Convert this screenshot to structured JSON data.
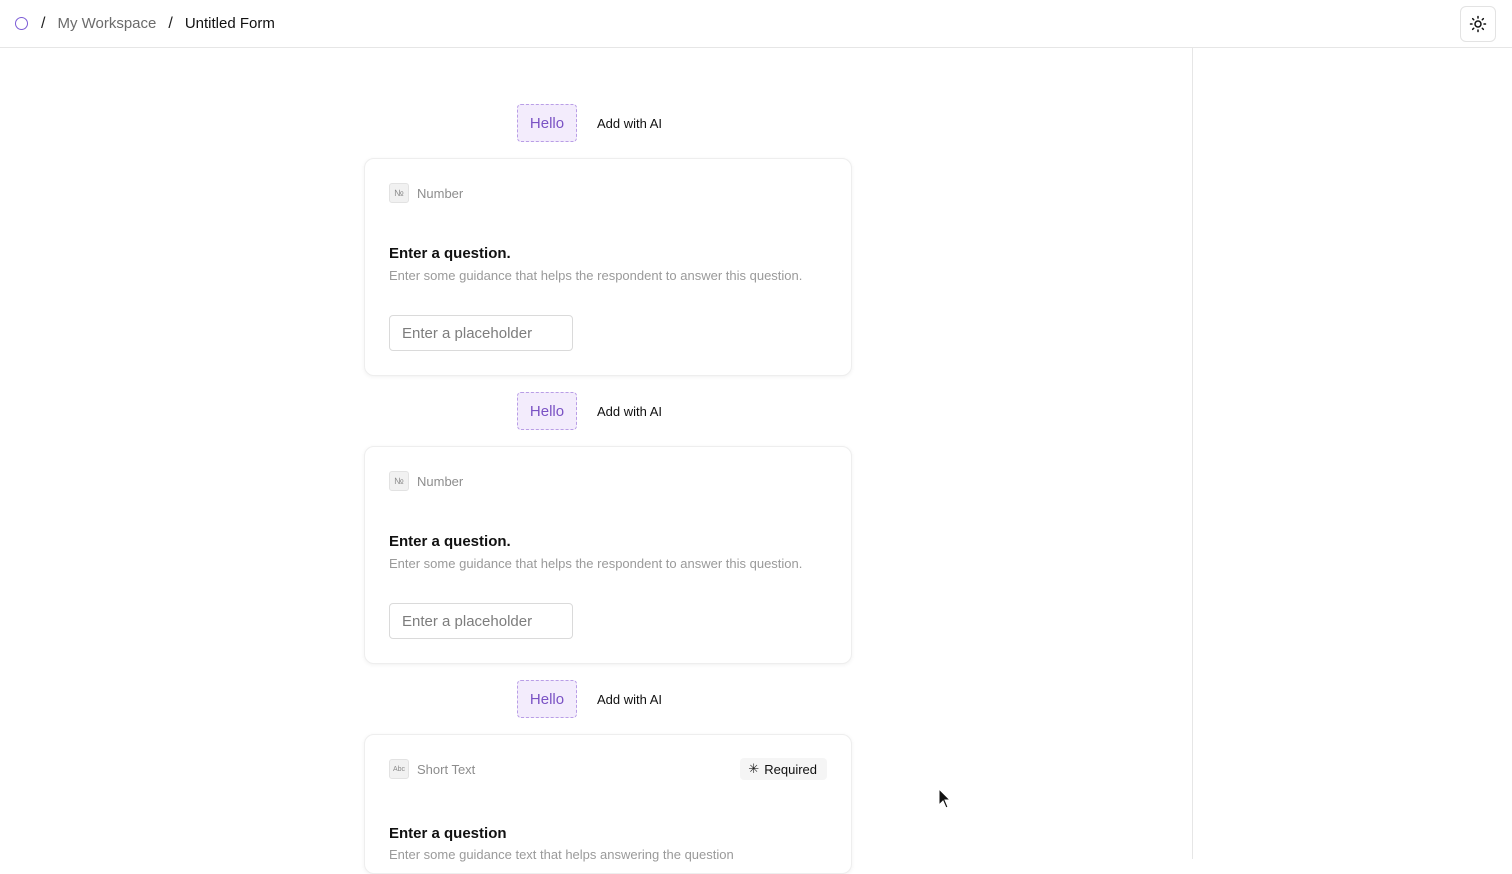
{
  "breadcrumb": {
    "separator": "/",
    "workspace": "My Workspace",
    "form": "Untitled Form"
  },
  "header": {
    "theme_icon": "sun-icon"
  },
  "adders": [
    {
      "hello_label": "Hello",
      "ai_label": "Add with AI"
    },
    {
      "hello_label": "Hello",
      "ai_label": "Add with AI"
    },
    {
      "hello_label": "Hello",
      "ai_label": "Add with AI"
    }
  ],
  "cards": [
    {
      "type_icon": "№",
      "type_label": "Number",
      "question": "Enter a question.",
      "guidance": "Enter some guidance that helps the respondent to answer this question.",
      "placeholder": "Enter a placeholder"
    },
    {
      "type_icon": "№",
      "type_label": "Number",
      "question": "Enter a question.",
      "guidance": "Enter some guidance that helps the respondent to answer this question.",
      "placeholder": "Enter a placeholder"
    },
    {
      "type_icon": "Abc",
      "type_label": "Short Text",
      "required_label": "Required",
      "question": "Enter a question",
      "guidance": "Enter some guidance text that helps answering the question"
    }
  ],
  "colors": {
    "accent": "#7a52c4",
    "accent_bg": "#f3ecfc",
    "border": "#e6e6e6"
  }
}
